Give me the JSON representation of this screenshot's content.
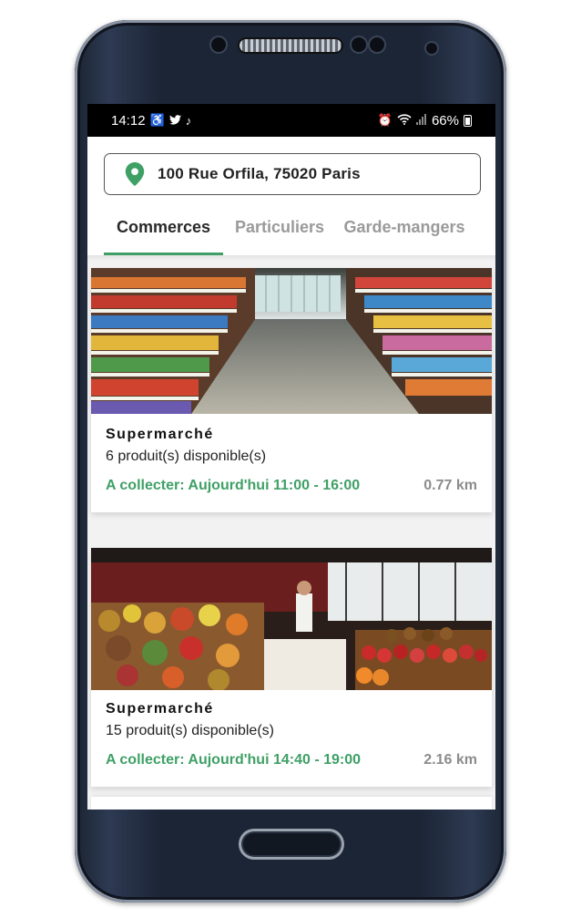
{
  "status_bar": {
    "time": "14:12",
    "battery": "66%",
    "left_icons": [
      "accessibility-icon",
      "twitter-icon",
      "tiktok-icon"
    ],
    "right_icons": [
      "alarm-icon",
      "wifi-icon",
      "signal-icon",
      "battery-icon"
    ]
  },
  "location": {
    "address": "100 Rue Orfila, 75020 Paris",
    "icon": "map-pin-icon",
    "accent": "#3fa066"
  },
  "tabs": [
    {
      "label": "Commerces",
      "active": true
    },
    {
      "label": "Particuliers",
      "active": false
    },
    {
      "label": "Garde-mangers",
      "active": false
    }
  ],
  "listings": [
    {
      "title": "Supermarché",
      "products": "6 produit(s) disponible(s)",
      "pickup": "A collecter: Aujourd'hui 11:00 - 16:00",
      "distance": "0.77 km",
      "image": "supermarket-aisle-photo"
    },
    {
      "title": "Supermarché",
      "products": "15 produit(s) disponible(s)",
      "pickup": "A collecter: Aujourd'hui 14:40 - 19:00",
      "distance": "2.16 km",
      "image": "fruit-stall-photo"
    }
  ],
  "colors": {
    "accent_green": "#3fa066",
    "muted_text": "#8c8c8c"
  }
}
